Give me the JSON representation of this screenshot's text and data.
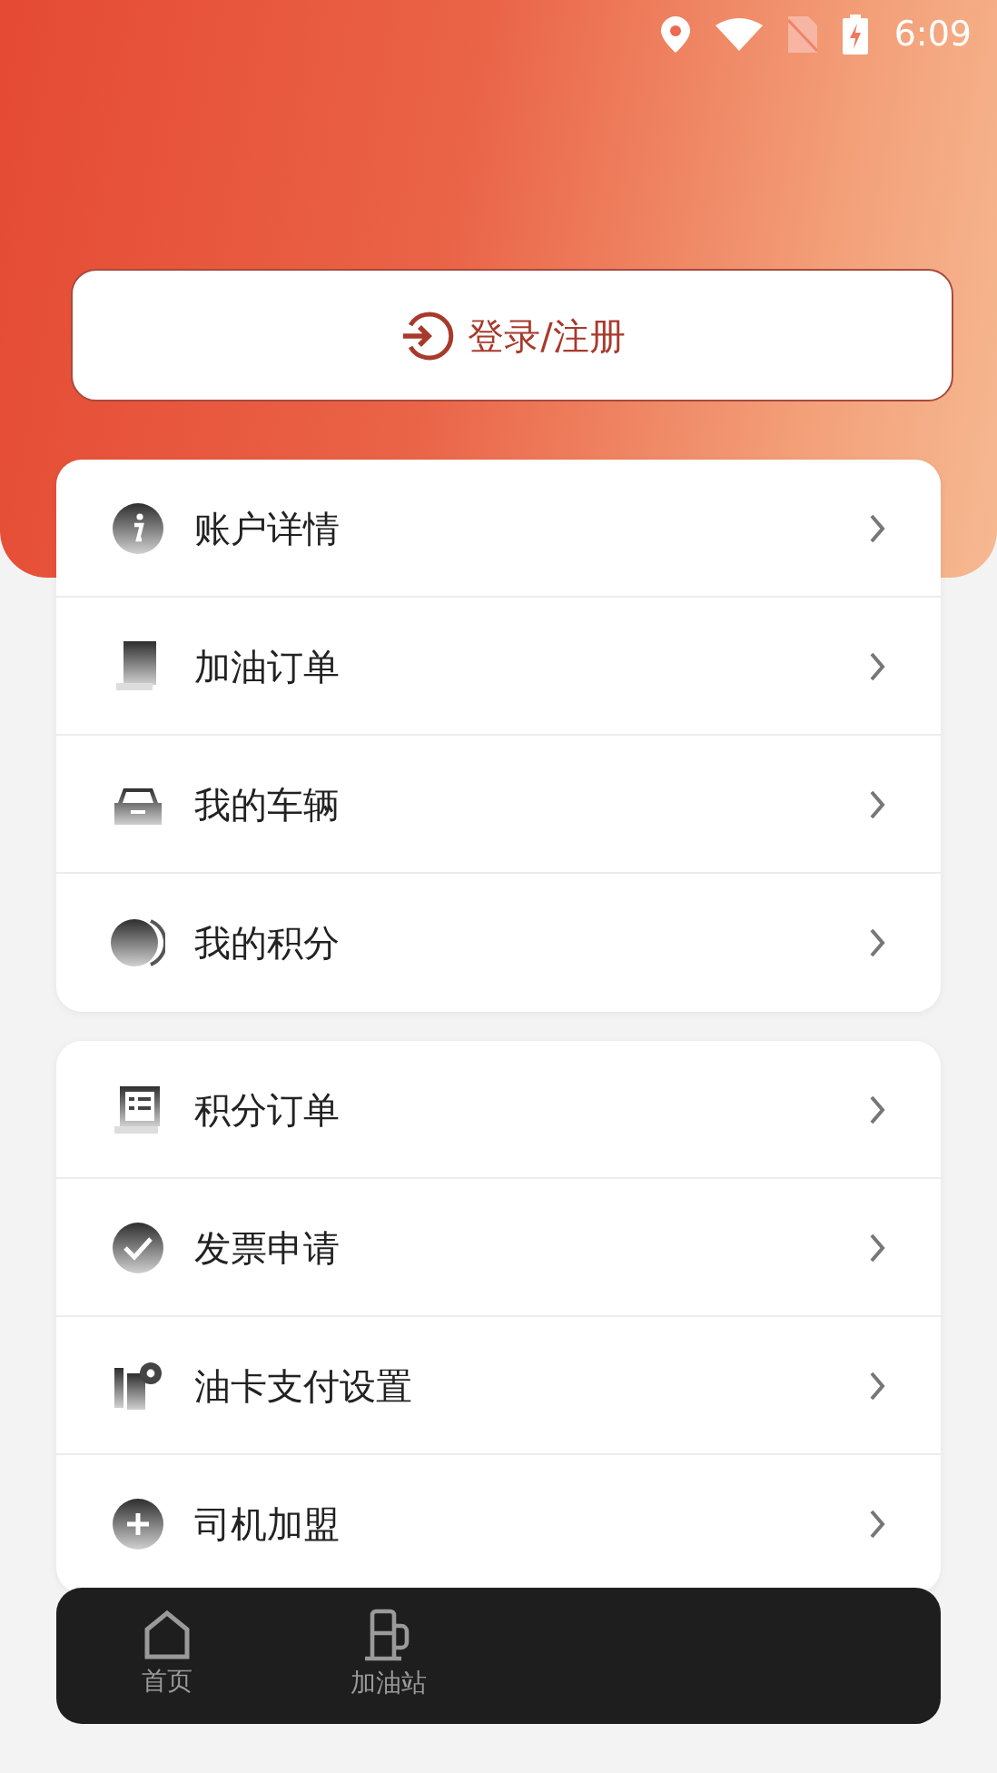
{
  "status_bar": {
    "time": "6:09"
  },
  "login_button": {
    "label": "登录/注册"
  },
  "menu_groups": [
    {
      "items": [
        {
          "label": "账户详情"
        },
        {
          "label": "加油订单"
        },
        {
          "label": "我的车辆"
        },
        {
          "label": "我的积分"
        }
      ]
    },
    {
      "items": [
        {
          "label": "积分订单"
        },
        {
          "label": "发票申请"
        },
        {
          "label": "油卡支付设置"
        },
        {
          "label": "司机加盟"
        }
      ]
    }
  ],
  "bottom_nav": [
    {
      "label": "首页"
    },
    {
      "label": "加油站"
    }
  ]
}
